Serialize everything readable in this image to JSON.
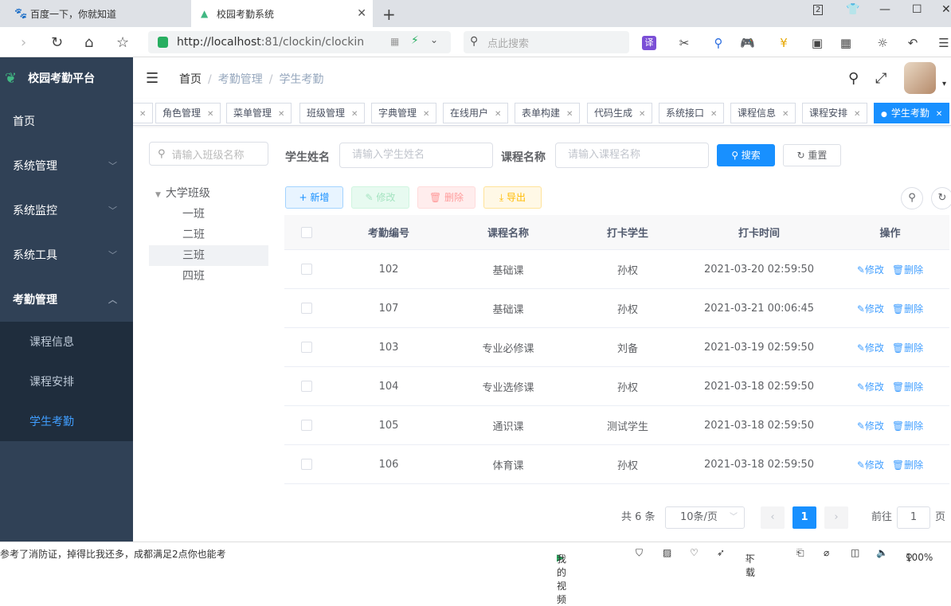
{
  "browser": {
    "tabs": [
      {
        "title": "百度一下，你就知道",
        "active": false
      },
      {
        "title": "校园考勤系统",
        "active": true
      }
    ],
    "window_badge": "2",
    "url_host": "http://localhost",
    "url_rest": ":81/clockin/clockin",
    "search_placeholder": "点此搜索"
  },
  "app": {
    "logo_text": "校园考勤平台",
    "menu": [
      {
        "label": "首页"
      },
      {
        "label": "系统管理",
        "has_children": true
      },
      {
        "label": "系统监控",
        "has_children": true
      },
      {
        "label": "系统工具",
        "has_children": true
      },
      {
        "label": "考勤管理",
        "has_children": true,
        "expanded": true
      }
    ],
    "submenu": [
      {
        "label": "课程信息",
        "active": false
      },
      {
        "label": "课程安排",
        "active": false
      },
      {
        "label": "学生考勤",
        "active": true
      }
    ],
    "breadcrumb": [
      "首页",
      "考勤管理",
      "学生考勤"
    ],
    "tags": [
      "角色管理",
      "菜单管理",
      "班级管理",
      "字典管理",
      "在线用户",
      "表单构建",
      "代码生成",
      "系统接口",
      "课程信息",
      "课程安排",
      "学生考勤"
    ],
    "tree": {
      "search_placeholder": "请输入班级名称",
      "root": "大学班级",
      "children": [
        "一班",
        "二班",
        "三班",
        "四班"
      ],
      "selected": "三班"
    },
    "query": {
      "student_label": "学生姓名",
      "student_placeholder": "请输入学生姓名",
      "course_label": "课程名称",
      "course_placeholder": "请输入课程名称",
      "search_btn": "搜索",
      "reset_btn": "重置"
    },
    "toolbar": {
      "add": "新增",
      "edit": "修改",
      "delete": "删除",
      "export": "导出"
    },
    "table": {
      "headers": [
        "考勤编号",
        "课程名称",
        "打卡学生",
        "打卡时间",
        "操作"
      ],
      "rows": [
        {
          "id": "102",
          "course": "基础课",
          "student": "孙权",
          "time": "2021-03-20 02:59:50"
        },
        {
          "id": "107",
          "course": "基础课",
          "student": "孙权",
          "time": "2021-03-21 00:06:45"
        },
        {
          "id": "103",
          "course": "专业必修课",
          "student": "刘备",
          "time": "2021-03-19 02:59:50"
        },
        {
          "id": "104",
          "course": "专业选修课",
          "student": "孙权",
          "time": "2021-03-18 02:59:50"
        },
        {
          "id": "105",
          "course": "通识课",
          "student": "测试学生",
          "time": "2021-03-18 02:59:50"
        },
        {
          "id": "106",
          "course": "体育课",
          "student": "孙权",
          "time": "2021-03-18 02:59:50"
        }
      ],
      "edit_link": "修改",
      "delete_link": "删除"
    },
    "pagination": {
      "total": "共 6 条",
      "page_size": "10条/页",
      "current": "1",
      "goto_label": "前往",
      "goto_value": "1",
      "goto_unit": "页"
    }
  },
  "statusbar": {
    "news": "参考了消防证，掉得比我还多，成都满足2点你也能考",
    "video": "我的视频",
    "download": "下载",
    "zoom": "100%"
  },
  "colors": {
    "sidebar": "#304156",
    "primary": "#1890ff",
    "link": "#409eff"
  }
}
